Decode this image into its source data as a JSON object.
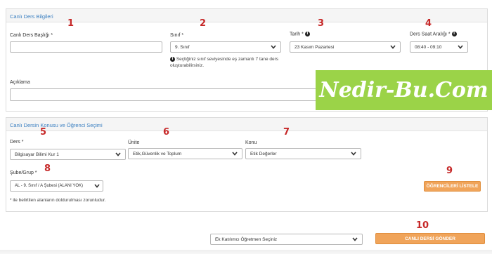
{
  "section1": {
    "title": "Canlı Ders Bilgileri",
    "lesson_title_label": "Canlı Ders Başlığı *",
    "lesson_title_value": "",
    "class_label": "Sınıf *",
    "class_value": "9. Sınıf",
    "class_note": "Seçtiğiniz sınıf seviyesinde eş zamanlı 7 tane ders oluşturabilirsiniz.",
    "date_label": "Tarih *",
    "date_value": "23 Kasım Pazartesi",
    "time_label": "Ders Saat Aralığı *",
    "time_value": "08:40 - 09:10",
    "description_label": "Açıklama",
    "description_value": ""
  },
  "section2": {
    "title": "Canlı Dersin Konusu ve Öğrenci Seçimi",
    "course_label": "Ders *",
    "course_value": "Bilgisayar Bilimi Kur 1",
    "unit_label": "Ünite",
    "unit_value": "Etik,Güvenlik ve Toplum",
    "topic_label": "Konu",
    "topic_value": "Etik Değerler",
    "branch_label": "Şube/Grup *",
    "branch_value": "AL - 9. Sınıf / A Şubesi (ALANI YOK)",
    "list_students_button": "ÖĞRENCİLERİ LİSTELE",
    "required_note": "* ile belirtilen alanların doldurulması zorunludur."
  },
  "footer": {
    "teacher_placeholder": "Ek Katılımcı Öğretmen Seçiniz",
    "send_button": "CANLI DERSİ GÖNDER"
  },
  "callouts": [
    "1",
    "2",
    "3",
    "4",
    "5",
    "6",
    "7",
    "8",
    "9",
    "10"
  ],
  "watermark": "Nedir-Bu.Com",
  "colors": {
    "accent": "#3a7fc1",
    "button": "#f0a45a",
    "callout": "#c62828",
    "watermark_bg": "#9bd348"
  }
}
